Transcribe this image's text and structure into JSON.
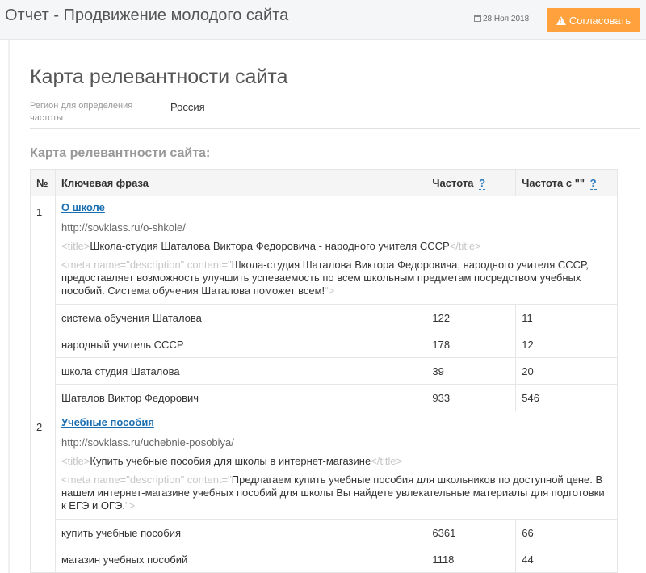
{
  "header": {
    "title": "Отчет - Продвижение молодого сайта",
    "date": "28 Ноя 2018",
    "approve_label": "Согласовать"
  },
  "page": {
    "title": "Карта релевантности сайта",
    "region_label": "Регион для определения частоты",
    "region_value": "Россия",
    "section_title": "Карта релевантности сайта:"
  },
  "table": {
    "columns": [
      "№",
      "Ключевая фраза",
      "Частота",
      "Частота с \"\""
    ],
    "help_mark": "?",
    "tags": {
      "title_open": "<title>",
      "title_close": "</title>",
      "meta_open": "<meta name=\"description\" content=\"",
      "meta_close": "\">"
    },
    "groups": [
      {
        "num": "1",
        "link": "О школе",
        "url": "http://sovklass.ru/o-shkole/",
        "title": "Школа-студия Шаталова Виктора Федоровича - народного учителя СССР",
        "description": "Школа-студия Шаталова Виктора Федоровича, народного учителя СССР, предоставляет возможность улучшить успеваемость по всем школьным предметам посредством учебных пособий. Система обучения Шаталова поможет всем!",
        "rows": [
          {
            "phrase": "система обучения Шаталова",
            "freq": "122",
            "freq_exact": "11"
          },
          {
            "phrase": "народный учитель СССР",
            "freq": "178",
            "freq_exact": "12"
          },
          {
            "phrase": "школа студия Шаталова",
            "freq": "39",
            "freq_exact": "20"
          },
          {
            "phrase": "Шаталов Виктор Федорович",
            "freq": "933",
            "freq_exact": "546"
          }
        ]
      },
      {
        "num": "2",
        "link": "Учебные пособия",
        "url": "http://sovklass.ru/uchebnie-posobiya/",
        "title": "Купить учебные пособия для школы в интернет-магазине",
        "description": "Предлагаем купить учебные пособия для школьников по доступной цене. В нашем интернет-магазине учебных пособий для школы Вы найдете увлекательные материалы для подготовки к ЕГЭ и ОГЭ.",
        "rows": [
          {
            "phrase": "купить учебные пособия",
            "freq": "6361",
            "freq_exact": "66"
          },
          {
            "phrase": "магазин учебных пособий",
            "freq": "1118",
            "freq_exact": "44"
          }
        ]
      }
    ]
  }
}
